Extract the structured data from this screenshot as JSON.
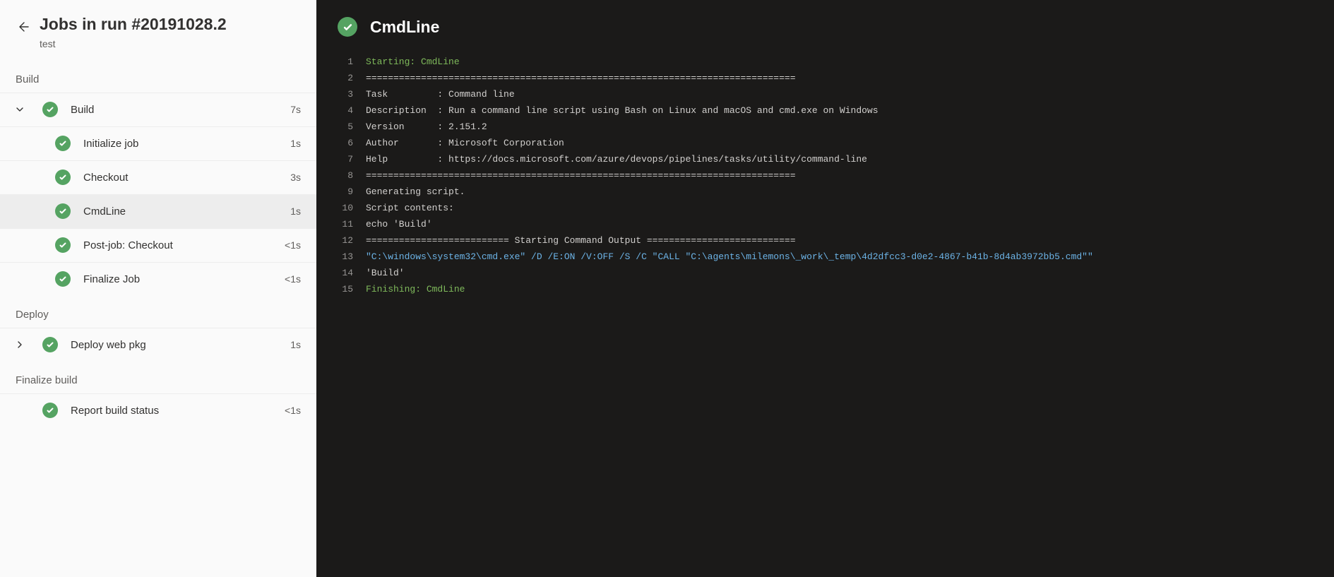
{
  "sidebar": {
    "title": "Jobs in run #20191028.2",
    "subtitle": "test",
    "stages": [
      {
        "label": "Build",
        "jobs": [
          {
            "label": "Build",
            "duration": "7s",
            "expanded": true,
            "tasks": [
              {
                "label": "Initialize job",
                "duration": "1s",
                "selected": false
              },
              {
                "label": "Checkout",
                "duration": "3s",
                "selected": false
              },
              {
                "label": "CmdLine",
                "duration": "1s",
                "selected": true
              },
              {
                "label": "Post-job: Checkout",
                "duration": "<1s",
                "selected": false
              },
              {
                "label": "Finalize Job",
                "duration": "<1s",
                "selected": false
              }
            ]
          }
        ]
      },
      {
        "label": "Deploy",
        "jobs": [
          {
            "label": "Deploy web pkg",
            "duration": "1s",
            "expanded": false,
            "tasks": []
          }
        ]
      },
      {
        "label": "Finalize build",
        "jobs": [
          {
            "label": "Report build status",
            "duration": "<1s",
            "no_chevron": true,
            "tasks": []
          }
        ]
      }
    ]
  },
  "content": {
    "title": "CmdLine",
    "log_lines": [
      {
        "n": 1,
        "cls": "c-green",
        "text": "Starting: CmdLine"
      },
      {
        "n": 2,
        "cls": "c-white",
        "text": "=============================================================================="
      },
      {
        "n": 3,
        "cls": "c-white",
        "text": "Task         : Command line"
      },
      {
        "n": 4,
        "cls": "c-white",
        "text": "Description  : Run a command line script using Bash on Linux and macOS and cmd.exe on Windows"
      },
      {
        "n": 5,
        "cls": "c-white",
        "text": "Version      : 2.151.2"
      },
      {
        "n": 6,
        "cls": "c-white",
        "text": "Author       : Microsoft Corporation"
      },
      {
        "n": 7,
        "cls": "c-white",
        "text": "Help         : https://docs.microsoft.com/azure/devops/pipelines/tasks/utility/command-line"
      },
      {
        "n": 8,
        "cls": "c-white",
        "text": "=============================================================================="
      },
      {
        "n": 9,
        "cls": "c-white",
        "text": "Generating script."
      },
      {
        "n": 10,
        "cls": "c-white",
        "text": "Script contents:"
      },
      {
        "n": 11,
        "cls": "c-white",
        "text": "echo 'Build'"
      },
      {
        "n": 12,
        "cls": "c-white",
        "text": "========================== Starting Command Output ==========================="
      },
      {
        "n": 13,
        "cls": "c-blue",
        "text": "\"C:\\windows\\system32\\cmd.exe\" /D /E:ON /V:OFF /S /C \"CALL \"C:\\agents\\milemons\\_work\\_temp\\4d2dfcc3-d0e2-4867-b41b-8d4ab3972bb5.cmd\"\""
      },
      {
        "n": 14,
        "cls": "c-white",
        "text": "'Build'"
      },
      {
        "n": 15,
        "cls": "c-green",
        "text": "Finishing: CmdLine"
      }
    ]
  }
}
